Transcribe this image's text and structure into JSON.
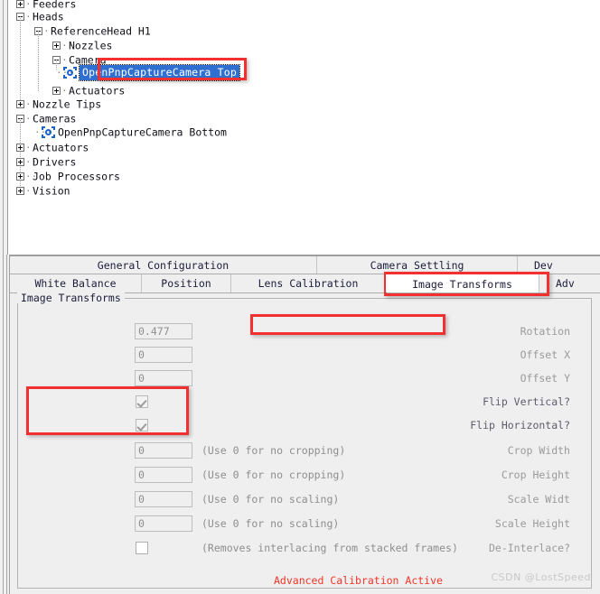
{
  "tree": {
    "items": [
      {
        "label": "Feeders",
        "state": "collapsed",
        "depth": 0,
        "icon": "plus-box-icon",
        "clipped": true
      },
      {
        "label": "Heads",
        "state": "expanded",
        "depth": 0,
        "icon": "minus-box-icon"
      },
      {
        "label": "ReferenceHead H1",
        "state": "expanded",
        "depth": 1,
        "icon": "minus-box-icon"
      },
      {
        "label": "Nozzles",
        "state": "collapsed",
        "depth": 2,
        "icon": "plus-box-icon"
      },
      {
        "label": "Camera",
        "state": "expanded",
        "depth": 2,
        "icon": "minus-box-icon"
      },
      {
        "label": "OpenPnpCaptureCamera Top",
        "state": "leaf",
        "depth": 3,
        "icon": "camera-icon",
        "selected": true
      },
      {
        "label": "Actuators",
        "state": "collapsed",
        "depth": 2,
        "icon": "plus-box-icon"
      },
      {
        "label": "Nozzle Tips",
        "state": "collapsed",
        "depth": 0,
        "icon": "plus-box-icon"
      },
      {
        "label": "Cameras",
        "state": "expanded",
        "depth": 0,
        "icon": "minus-box-icon"
      },
      {
        "label": "OpenPnpCaptureCamera Bottom",
        "state": "leaf",
        "depth": 1,
        "icon": "camera-icon"
      },
      {
        "label": "Actuators",
        "state": "collapsed",
        "depth": 0,
        "icon": "plus-box-icon"
      },
      {
        "label": "Drivers",
        "state": "collapsed",
        "depth": 0,
        "icon": "plus-box-icon"
      },
      {
        "label": "Job Processors",
        "state": "collapsed",
        "depth": 0,
        "icon": "plus-box-icon"
      },
      {
        "label": "Vision",
        "state": "collapsed",
        "depth": 0,
        "icon": "plus-box-icon"
      }
    ]
  },
  "tabs": {
    "row1": [
      {
        "label": "General Configuration",
        "selected": false
      },
      {
        "label": "Camera Settling",
        "selected": false
      },
      {
        "label": "Dev",
        "selected": false,
        "clipped": true
      }
    ],
    "row2": [
      {
        "label": "White Balance",
        "selected": false
      },
      {
        "label": "Position",
        "selected": false
      },
      {
        "label": "Lens Calibration",
        "selected": false
      },
      {
        "label": "Image Transforms",
        "selected": true
      },
      {
        "label": "Adv",
        "selected": false,
        "clipped": true
      }
    ]
  },
  "panel": {
    "group_title": "Image Transforms",
    "status_note": "Advanced Calibration Active",
    "status_color": "#f0342a",
    "fields": [
      {
        "label": "Rotation",
        "value": "0.477",
        "hint": "",
        "type": "text"
      },
      {
        "label": "Offset X",
        "value": "0",
        "hint": "",
        "type": "text"
      },
      {
        "label": "Offset Y",
        "value": "0",
        "hint": "",
        "type": "text"
      },
      {
        "label": "Flip Vertical?",
        "value": "",
        "hint": "",
        "type": "checkbox",
        "checked": true
      },
      {
        "label": "Flip Horizontal?",
        "value": "",
        "hint": "",
        "type": "checkbox",
        "checked": true
      },
      {
        "label": "Crop Width",
        "value": "0",
        "hint": "(Use 0 for no cropping)",
        "type": "text"
      },
      {
        "label": "Crop Height",
        "value": "0",
        "hint": "(Use 0 for no cropping)",
        "type": "text"
      },
      {
        "label": "Scale Widt",
        "value": "0",
        "hint": "(Use 0 for no scaling)",
        "type": "text"
      },
      {
        "label": "Scale Height",
        "value": "0",
        "hint": "(Use 0 for no scaling)",
        "type": "text"
      },
      {
        "label": "De-Interlace?",
        "value": "",
        "hint": "(Removes interlacing from stacked frames)",
        "type": "checkbox",
        "checked": false
      }
    ]
  },
  "annotations": {
    "highlight_color": "#f23030",
    "boxes": [
      {
        "name": "selected-tree-node-highlight"
      },
      {
        "name": "image-transforms-tab-highlight"
      },
      {
        "name": "advanced-calibration-active-highlight"
      },
      {
        "name": "flip-checkboxes-highlight"
      }
    ]
  },
  "watermark": {
    "text": "CSDN @LostSpeed"
  }
}
